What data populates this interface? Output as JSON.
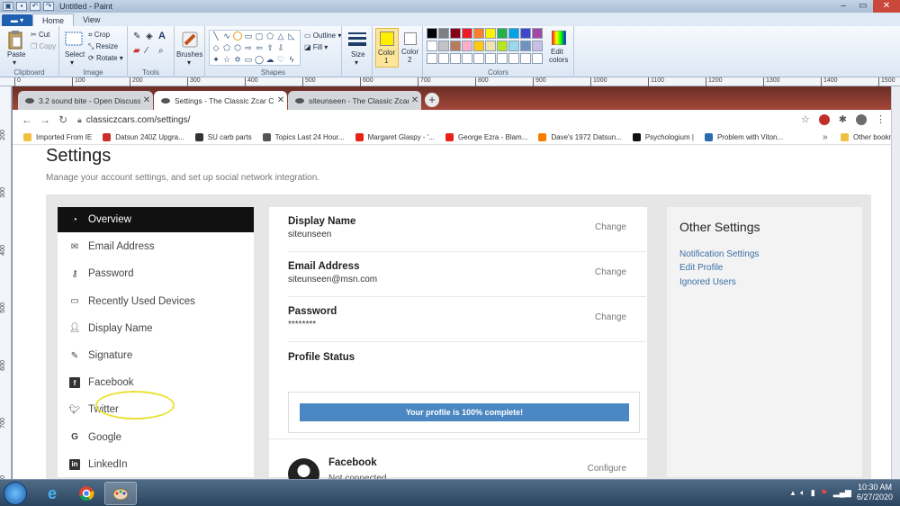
{
  "paint": {
    "window_title": "Untitled - Paint",
    "ribbon_tabs": [
      "Home",
      "View"
    ],
    "clipboard": {
      "paste": "Paste",
      "cut": "Cut",
      "copy": "Copy",
      "group": "Clipboard"
    },
    "image": {
      "select": "Select",
      "crop": "Crop",
      "resize": "Resize",
      "rotate": "Rotate",
      "group": "Image"
    },
    "tools": {
      "group": "Tools"
    },
    "brushes": {
      "label": "Brushes"
    },
    "shapes": {
      "outline": "Outline",
      "fill": "Fill",
      "group": "Shapes"
    },
    "size": {
      "label": "Size"
    },
    "color1": {
      "label": "Color",
      "num": "1",
      "value": "#ffee00"
    },
    "color2": {
      "label": "Color",
      "num": "2",
      "value": "#ffffff"
    },
    "colors": {
      "group": "Colors",
      "edit": "Edit",
      "edit2": "colors"
    },
    "palette": [
      "#000000",
      "#7f7f7f",
      "#880015",
      "#ed1c24",
      "#ff7f27",
      "#fff200",
      "#22b14c",
      "#00a2e8",
      "#3f48cc",
      "#a349a4",
      "#ffffff",
      "#c3c3c3",
      "#b97a57",
      "#ffaec9",
      "#ffc90e",
      "#efe4b0",
      "#b5e61d",
      "#99d9ea",
      "#7092be",
      "#c8bfe7"
    ],
    "ruler_top": [
      "0",
      "100",
      "200",
      "300",
      "400",
      "500",
      "600",
      "700",
      "800",
      "900",
      "1000",
      "1100",
      "1200",
      "1300",
      "1400",
      "1500"
    ],
    "ruler_left": [
      "200",
      "300",
      "400",
      "500",
      "600",
      "700",
      "800"
    ]
  },
  "browser": {
    "tabs": [
      {
        "label": "3.2 sound bite - Open Discussion",
        "close": "✕"
      },
      {
        "label": "Settings - The Classic Zcar Club",
        "close": "✕"
      },
      {
        "label": "siteunseen - The Classic Zcar Club",
        "close": "✕"
      }
    ],
    "new_tab": "+",
    "url": "classiczcars.com/settings/",
    "bookmarks": [
      {
        "label": "Imported From IE",
        "color": "#f0c040"
      },
      {
        "label": "Datsun 240Z Upgra...",
        "color": "#c9302c"
      },
      {
        "label": "SU carb parts",
        "color": "#333333"
      },
      {
        "label": "Topics Last 24 Hour...",
        "color": "#555555"
      },
      {
        "label": "Margaret Glaspy - '...",
        "color": "#e62117"
      },
      {
        "label": "George Ezra - Blam...",
        "color": "#e62117"
      },
      {
        "label": "Dave's 1972 Datsun...",
        "color": "#f57d00"
      },
      {
        "label": "Psychologium |",
        "color": "#111111"
      },
      {
        "label": "Problem with Viton...",
        "color": "#2b6cb0"
      }
    ],
    "bookmarks_more": "»",
    "other_bookmarks": "Other bookm"
  },
  "page": {
    "title": "Settings",
    "subtitle": "Manage your account settings, and set up social network integration.",
    "sidebar": [
      {
        "label": "Overview",
        "icon": "dashboard-icon"
      },
      {
        "label": "Email Address",
        "icon": "envelope-icon"
      },
      {
        "label": "Password",
        "icon": "key-icon"
      },
      {
        "label": "Recently Used Devices",
        "icon": "laptop-icon"
      },
      {
        "label": "Display Name",
        "icon": "user-icon"
      },
      {
        "label": "Signature",
        "icon": "pencil-icon"
      },
      {
        "label": "Facebook",
        "icon": "facebook-icon"
      },
      {
        "label": "Twitter",
        "icon": "twitter-icon"
      },
      {
        "label": "Google",
        "icon": "google-icon"
      },
      {
        "label": "LinkedIn",
        "icon": "linkedin-icon"
      }
    ],
    "settings": [
      {
        "name": "Display Name",
        "value": "siteunseen",
        "action": "Change"
      },
      {
        "name": "Email Address",
        "value": "siteunseen@msn.com",
        "action": "Change"
      },
      {
        "name": "Password",
        "value": "********",
        "action": "Change"
      }
    ],
    "profile_status": {
      "title": "Profile Status",
      "text": "Your profile is 100% complete!",
      "percent": 100,
      "bar_color": "#4b87c2"
    },
    "facebook": {
      "name": "Facebook",
      "status": "Not connected",
      "action": "Configure"
    },
    "other_settings": {
      "title": "Other Settings",
      "links": [
        "Notification Settings",
        "Edit Profile",
        "Ignored Users"
      ]
    },
    "annotation_color": "#ece13a"
  },
  "taskbar": {
    "time": "10:30 AM",
    "date": "6/27/2020"
  }
}
